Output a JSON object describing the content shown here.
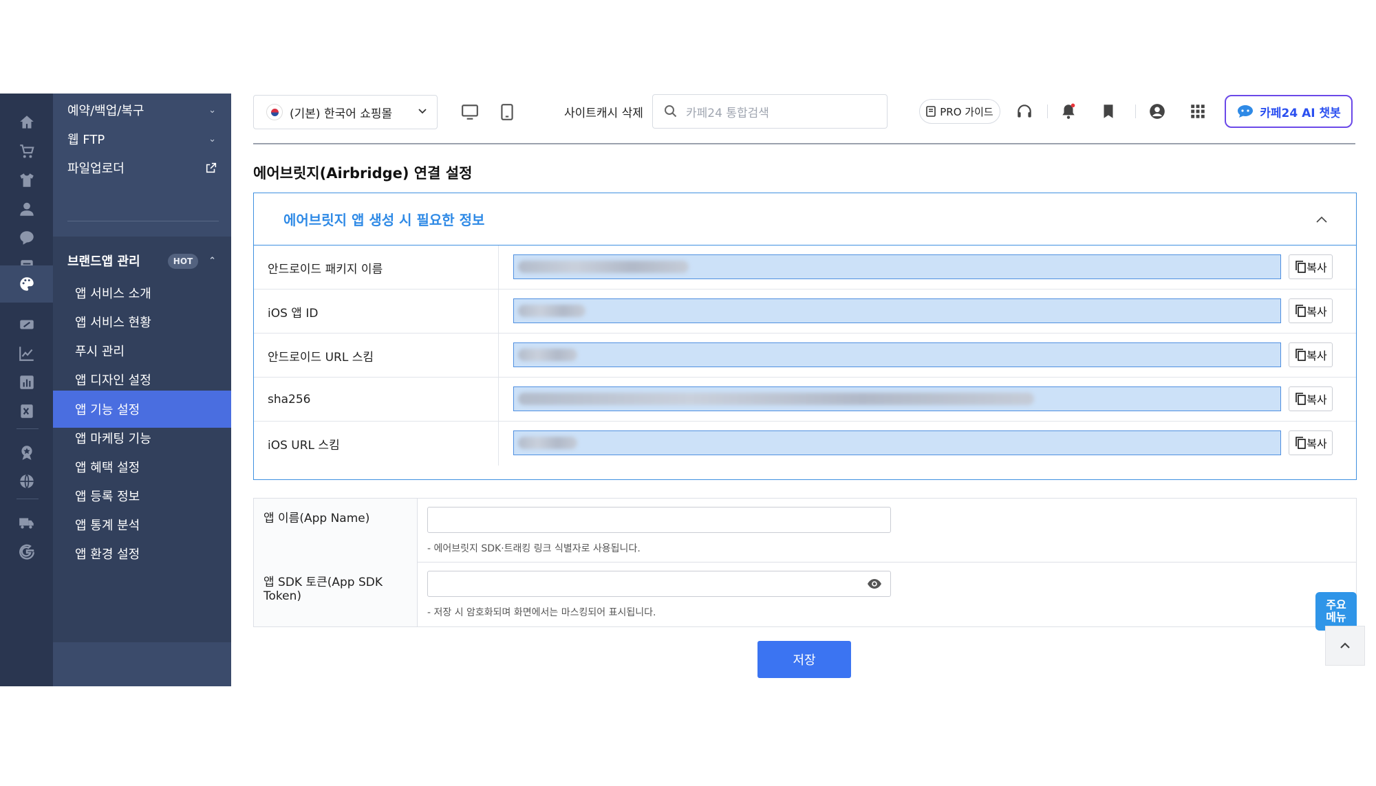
{
  "sidebar_rail": {
    "icons": [
      "home-icon",
      "cart-icon",
      "shirt-icon",
      "user-icon",
      "chat-icon",
      "board-icon",
      "palette-icon",
      "promotion-icon",
      "analytics-icon",
      "report-icon",
      "excel-icon",
      "award-icon",
      "globe-icon",
      "truck-icon",
      "google-icon"
    ]
  },
  "submenu": {
    "top_items": [
      {
        "label": "예약/백업/복구"
      },
      {
        "label": "웹 FTP"
      },
      {
        "label": "파일업로더"
      }
    ],
    "group": {
      "label": "브랜드앱 관리",
      "badge": "HOT",
      "items": [
        {
          "label": "앱 서비스 소개"
        },
        {
          "label": "앱 서비스 현황"
        },
        {
          "label": "푸시 관리"
        },
        {
          "label": "앱 디자인 설정"
        },
        {
          "label": "앱 기능 설정"
        },
        {
          "label": "앱 마케팅 기능"
        },
        {
          "label": "앱 혜택 설정"
        },
        {
          "label": "앱 등록 정보"
        },
        {
          "label": "앱 통계 분석"
        },
        {
          "label": "앱 환경 설정"
        }
      ]
    }
  },
  "topbar": {
    "mall_select": "(기본) 한국어 쇼핑몰",
    "cache_button": "사이트캐시 삭제",
    "search_placeholder": "카페24 통합검색",
    "pro_guide": "PRO 가이드",
    "ai_button": "카페24 AI 챗봇"
  },
  "main": {
    "page_title": "에어브릿지(Airbridge) 연결 설정",
    "panel": {
      "title": "에어브릿지 앱 생성 시 필요한 정보",
      "copy_label": "복사",
      "rows": [
        {
          "label": "안드로이드 패키지 이름"
        },
        {
          "label": "iOS 앱 ID"
        },
        {
          "label": "안드로이드 URL 스킴"
        },
        {
          "label": "sha256"
        },
        {
          "label": "iOS URL 스킴"
        }
      ]
    },
    "form": {
      "app_name_label": "앱 이름(App Name)",
      "app_name_value": "",
      "app_name_help": "- 에어브릿지 SDK·트래킹 링크 식별자로 사용됩니다.",
      "sdk_token_label": "앱 SDK 토큰(App SDK Token)",
      "sdk_token_value": "",
      "sdk_token_help": "- 저장 시 암호화되며 화면에서는 마스킹되어 표시됩니다."
    },
    "save_button": "저장",
    "quick_menu": {
      "line1": "주요",
      "line2": "메뉴"
    }
  },
  "colors": {
    "rail_bg": "#2a3650",
    "submenu_bg": "#3b4b6b",
    "active_item": "#4a6ee0",
    "accent_blue": "#2f8ae6",
    "save_button": "#3b74f2",
    "ai_border": "#6a48e8"
  }
}
